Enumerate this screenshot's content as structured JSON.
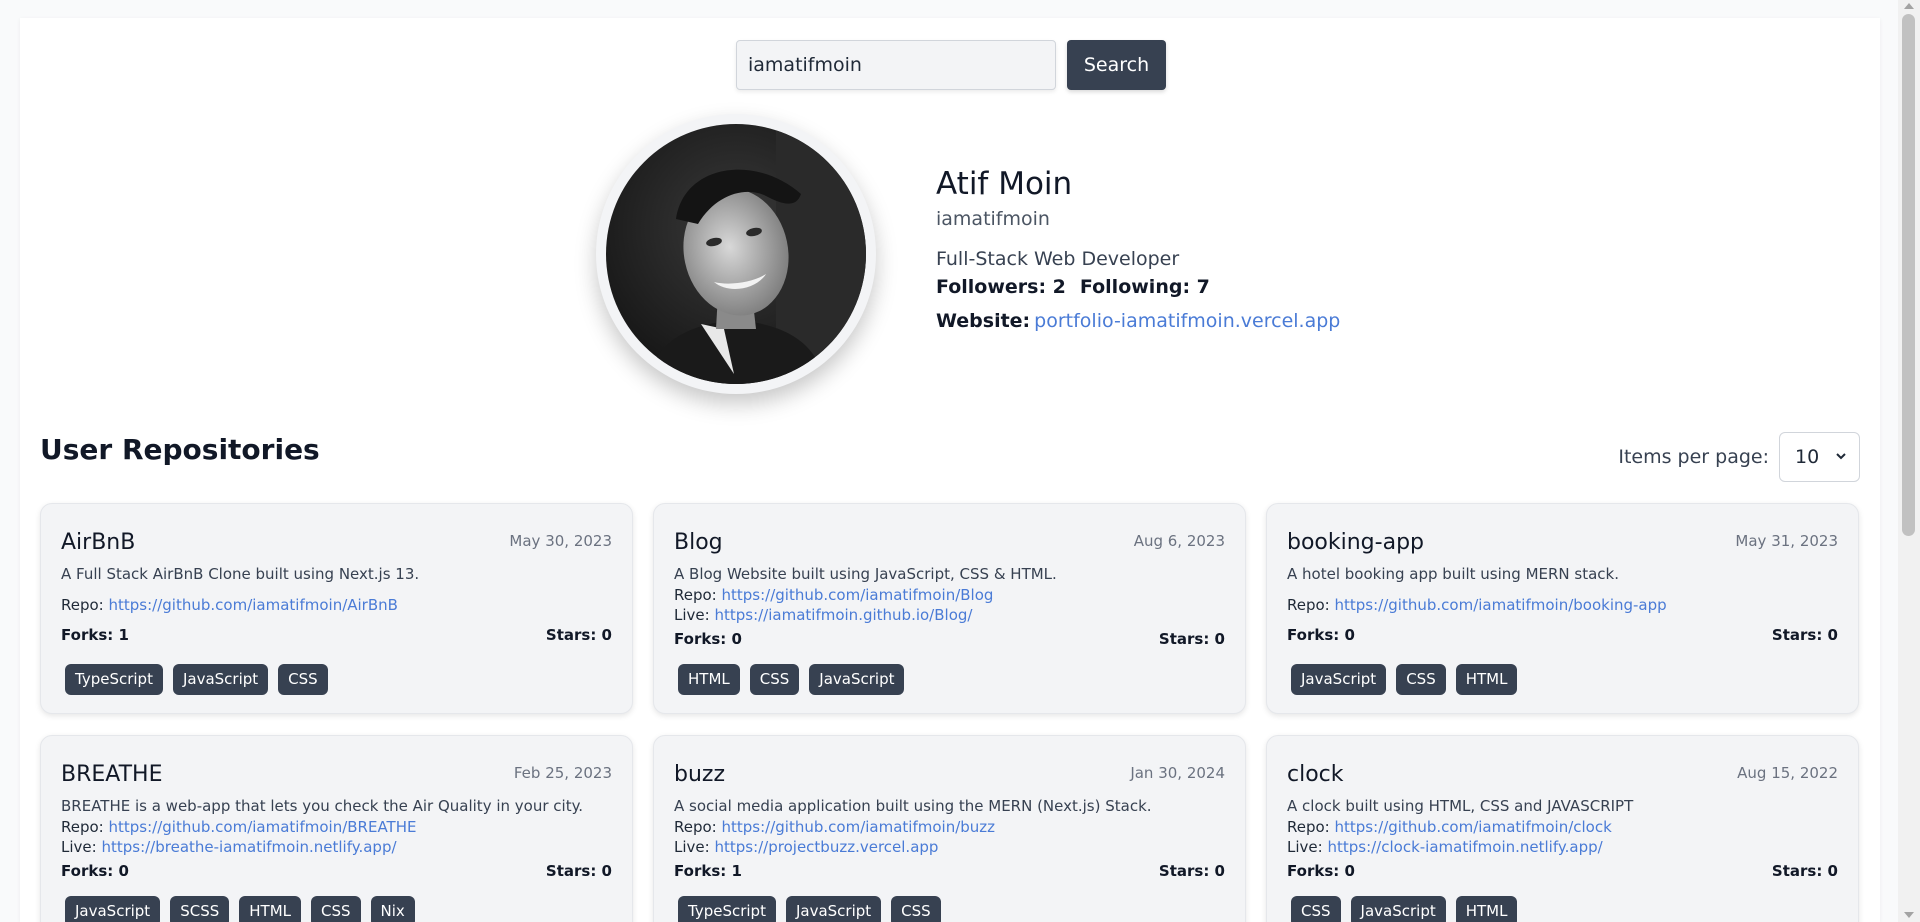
{
  "search": {
    "value": "iamatifmoin",
    "button_label": "Search"
  },
  "profile": {
    "name": "Atif Moin",
    "login": "iamatifmoin",
    "bio": "Full-Stack Web Developer",
    "followers": "Followers: 2",
    "following": "Following: 7",
    "website_label": "Website:",
    "website": "portfolio-iamatifmoin.vercel.app"
  },
  "repos_header": {
    "title": "User Repositories",
    "per_page_label": "Items per page:",
    "per_page_value": "10"
  },
  "labels": {
    "repo": "Repo:",
    "live": "Live:"
  },
  "repos": [
    {
      "name": "AirBnB",
      "date": "May 30, 2023",
      "description": "A Full Stack AirBnB Clone built using Next.js 13.",
      "repo": "https://github.com/iamatifmoin/AirBnB",
      "live": null,
      "forks": "Forks: 1",
      "stars": "Stars: 0",
      "tags": [
        "TypeScript",
        "JavaScript",
        "CSS"
      ]
    },
    {
      "name": "Blog",
      "date": "Aug 6, 2023",
      "description": "A Blog Website built using JavaScript, CSS & HTML.",
      "repo": "https://github.com/iamatifmoin/Blog",
      "live": "https://iamatifmoin.github.io/Blog/",
      "forks": "Forks: 0",
      "stars": "Stars: 0",
      "tags": [
        "HTML",
        "CSS",
        "JavaScript"
      ]
    },
    {
      "name": "booking-app",
      "date": "May 31, 2023",
      "description": "A hotel booking app built using MERN stack.",
      "repo": "https://github.com/iamatifmoin/booking-app",
      "live": null,
      "forks": "Forks: 0",
      "stars": "Stars: 0",
      "tags": [
        "JavaScript",
        "CSS",
        "HTML"
      ]
    },
    {
      "name": "BREATHE",
      "date": "Feb 25, 2023",
      "description": "BREATHE is a web-app that lets you check the Air Quality in your city.",
      "repo": "https://github.com/iamatifmoin/BREATHE",
      "live": "https://breathe-iamatifmoin.netlify.app/",
      "forks": "Forks: 0",
      "stars": "Stars: 0",
      "tags": [
        "JavaScript",
        "SCSS",
        "HTML",
        "CSS",
        "Nix"
      ]
    },
    {
      "name": "buzz",
      "date": "Jan 30, 2024",
      "description": "A social media application built using the MERN (Next.js) Stack.",
      "repo": "https://github.com/iamatifmoin/buzz",
      "live": "https://projectbuzz.vercel.app",
      "forks": "Forks: 1",
      "stars": "Stars: 0",
      "tags": [
        "TypeScript",
        "JavaScript",
        "CSS"
      ]
    },
    {
      "name": "clock",
      "date": "Aug 15, 2022",
      "description": "A clock built using HTML, CSS and JAVASCRIPT",
      "repo": "https://github.com/iamatifmoin/clock",
      "live": "https://clock-iamatifmoin.netlify.app/",
      "forks": "Forks: 0",
      "stars": "Stars: 0",
      "tags": [
        "CSS",
        "JavaScript",
        "HTML"
      ]
    }
  ],
  "colors": {
    "accent": "#374151",
    "link": "#4a7bd6",
    "card_bg": "#f3f4f6"
  }
}
